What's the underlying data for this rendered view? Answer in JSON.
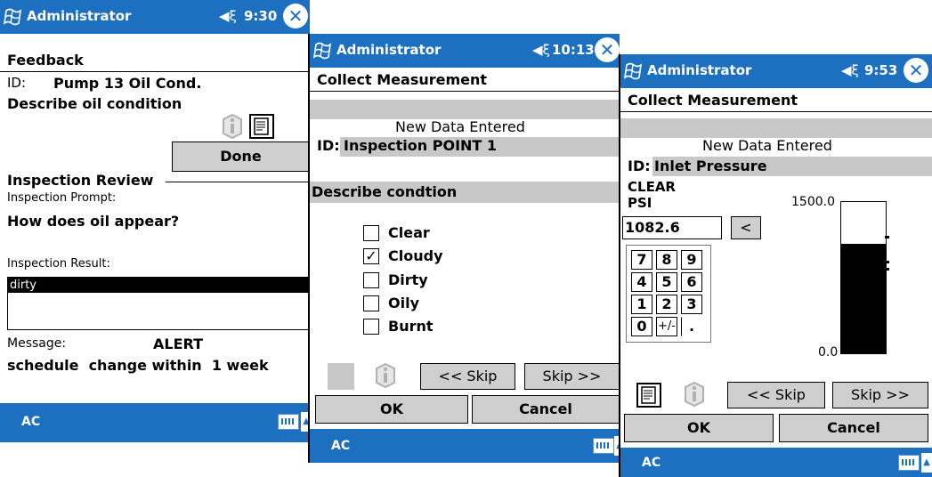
{
  "status": {
    "user": "Administrator",
    "time_feedback": "9:30",
    "time_collect1": "10:13",
    "time_collect2": "9:53",
    "speaker": "◀ξ",
    "close": "✕",
    "soft_key": "AC"
  },
  "feedback": {
    "header": "Feedback",
    "id_label": "ID:",
    "id_value": "Pump 13 Oil Cond.",
    "describe": "Describe oil condition",
    "done_label": "Done",
    "review_title": "Inspection Review",
    "prompt_label": "Inspection Prompt:",
    "prompt_value": "How does oil appear?",
    "result_label": "Inspection Result:",
    "result_value": "dirty",
    "message_label": "Message:",
    "message_level": "ALERT",
    "message_text": "schedule  change within  1 week"
  },
  "collect1": {
    "header": "Collect Measurement",
    "new_data": "New Data Entered",
    "id_label": "ID:",
    "id_value": "Inspection POINT 1",
    "describe": "Describe condtion",
    "options": [
      {
        "label": "Clear",
        "checked": false
      },
      {
        "label": "Cloudy",
        "checked": true
      },
      {
        "label": "Dirty",
        "checked": false
      },
      {
        "label": "Oily",
        "checked": false
      },
      {
        "label": "Burnt",
        "checked": false
      }
    ],
    "skip_back": "<< Skip",
    "skip_fwd": "Skip >>",
    "ok": "OK",
    "cancel": "Cancel"
  },
  "collect2": {
    "header": "Collect Measurement",
    "new_data": "New Data Entered",
    "id_label": "ID:",
    "id_value": "Inlet Pressure",
    "state": "CLEAR",
    "unit": "PSI",
    "value": "1082.6",
    "backspace": "<",
    "keys": [
      "7",
      "8",
      "9",
      "4",
      "5",
      "6",
      "1",
      "2",
      "3",
      "0",
      "+/-",
      "."
    ],
    "gauge_max": "1500.0",
    "gauge_min": "0.0",
    "gauge_fill": 0.7217,
    "skip_back": "<< Skip",
    "skip_fwd": "Skip >>",
    "ok": "OK",
    "cancel": "Cancel"
  },
  "colors": {
    "titlebar": "#1d6fc0",
    "panel_gray": "#c8c8c8"
  }
}
